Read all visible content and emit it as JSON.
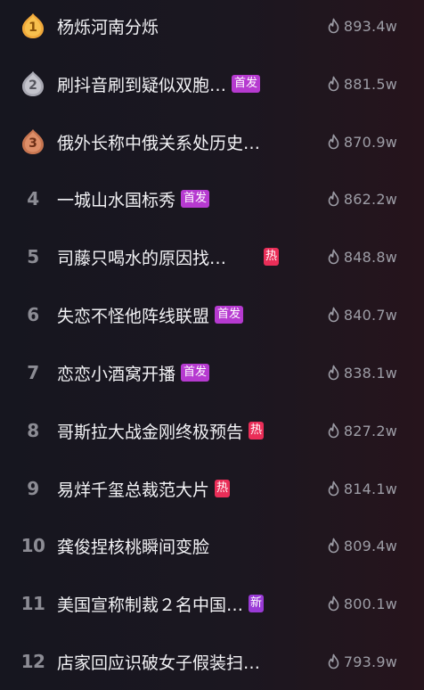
{
  "colors": {
    "tag_shoufa": "#b63ad0",
    "tag_re": "#ea2e58",
    "tag_xin": "#9a3ad6",
    "medal_gold": "#f0a83a",
    "medal_silver": "#a8a8b2",
    "medal_bronze": "#c77550"
  },
  "icons": {
    "heat": "flame-icon",
    "medal": "medal-icon"
  },
  "items": [
    {
      "rank": "1",
      "title": "杨烁河南分烁",
      "tag": "",
      "heat": "893.4w"
    },
    {
      "rank": "2",
      "title": "刷抖音刷到疑似双胞…",
      "tag": "首发",
      "heat": "881.5w"
    },
    {
      "rank": "3",
      "title": "俄外长称中俄关系处历史…",
      "tag": "",
      "heat": "870.9w"
    },
    {
      "rank": "4",
      "title": "一城山水国标秀",
      "tag": "首发",
      "heat": "862.2w"
    },
    {
      "rank": "5",
      "title": "司藤只喝水的原因找…",
      "tag": "热",
      "heat": "848.8w"
    },
    {
      "rank": "6",
      "title": "失恋不怪他阵线联盟",
      "tag": "首发",
      "heat": "840.7w"
    },
    {
      "rank": "7",
      "title": "恋恋小酒窝开播",
      "tag": "首发",
      "heat": "838.1w"
    },
    {
      "rank": "8",
      "title": "哥斯拉大战金刚终极预告",
      "tag": "热",
      "heat": "827.2w"
    },
    {
      "rank": "9",
      "title": "易烊千玺总裁范大片",
      "tag": "热",
      "heat": "814.1w"
    },
    {
      "rank": "10",
      "title": "龚俊捏核桃瞬间变脸",
      "tag": "",
      "heat": "809.4w"
    },
    {
      "rank": "11",
      "title": "美国宣称制裁２名中国…",
      "tag": "新",
      "heat": "800.1w"
    },
    {
      "rank": "12",
      "title": "店家回应识破女子假装扫…",
      "tag": "",
      "heat": "793.9w"
    }
  ]
}
